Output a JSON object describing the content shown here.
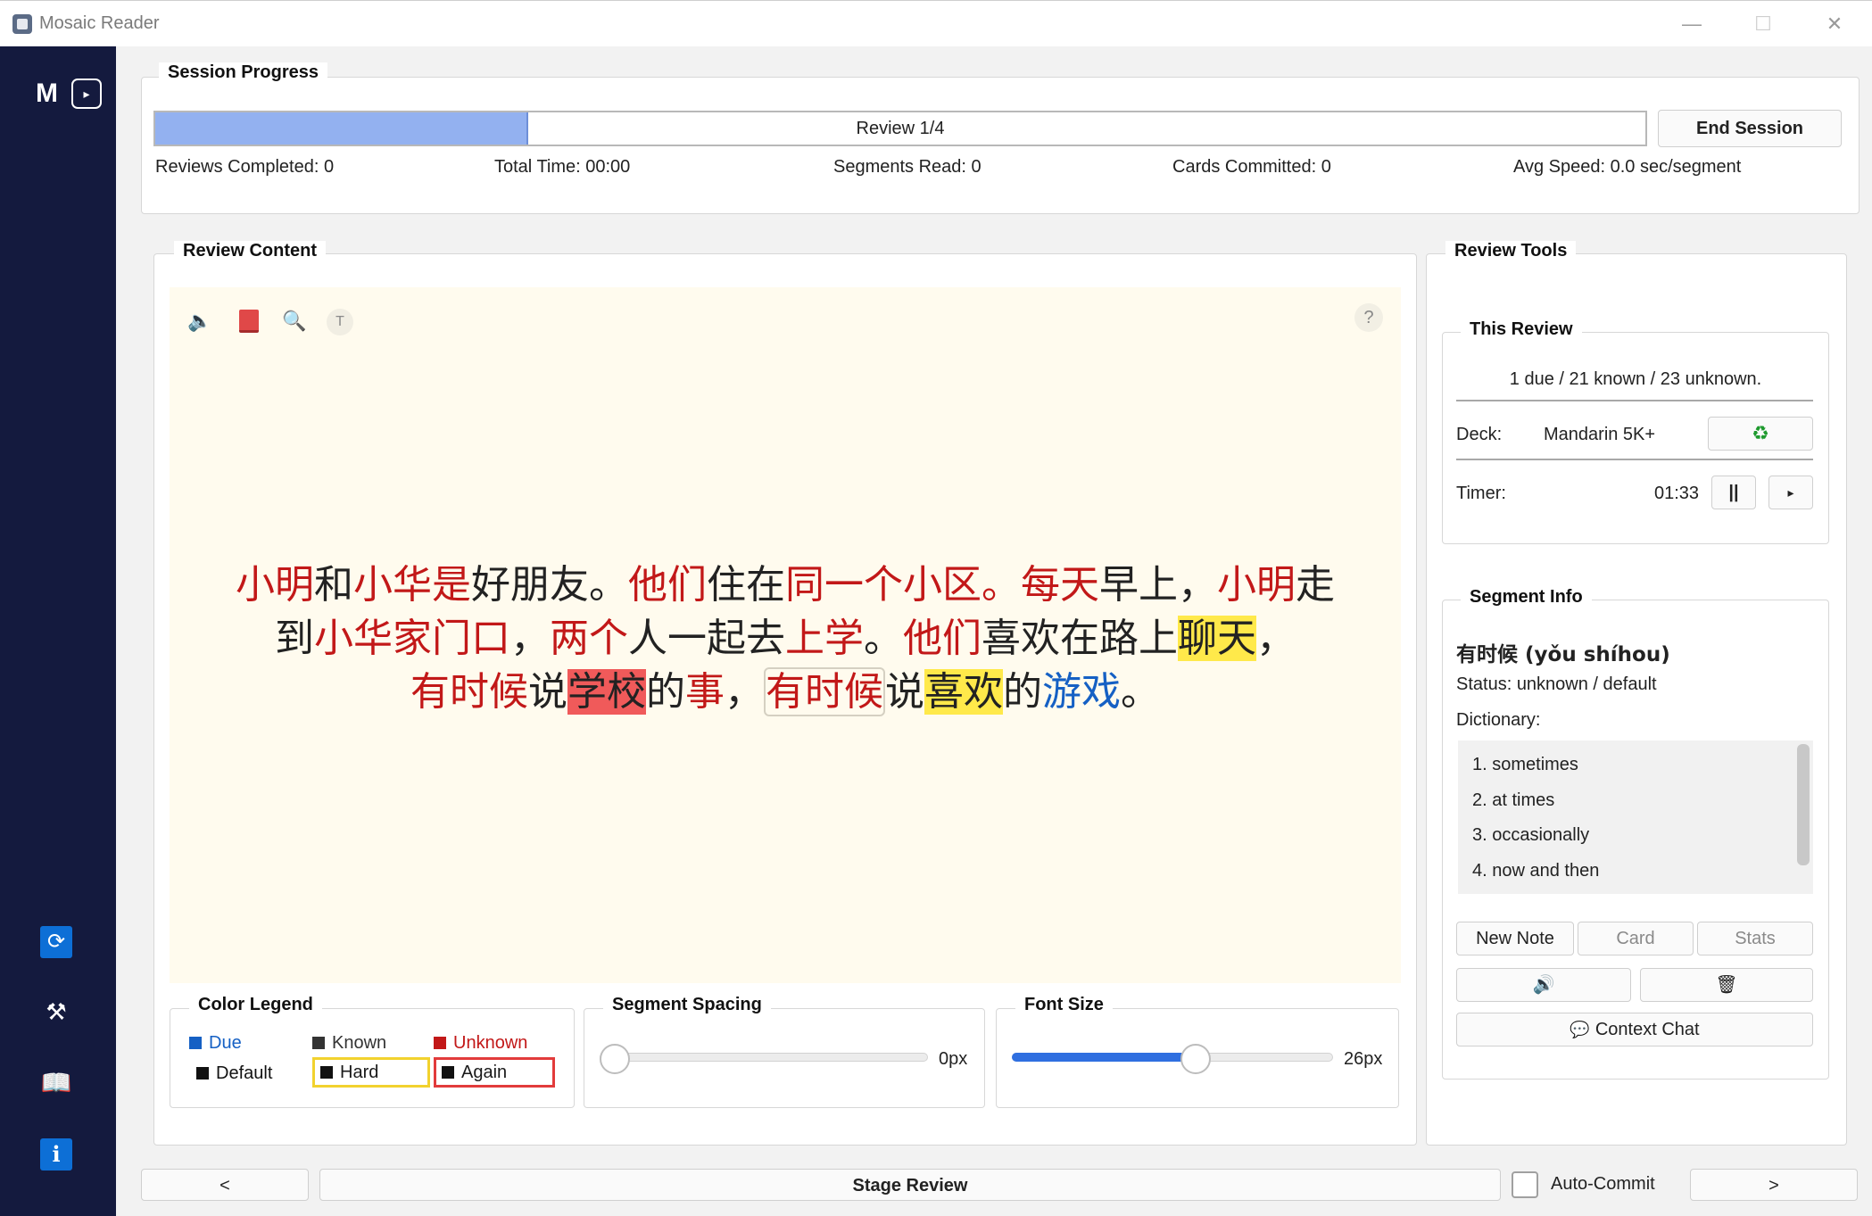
{
  "window": {
    "title": "Mosaic Reader",
    "controls": {
      "minimize": "—",
      "maximize": "☐",
      "close": "✕"
    }
  },
  "sidebar": {
    "logo_letter": "M",
    "logo_icon": "▸",
    "icons": [
      {
        "name": "sync-icon",
        "glyph": "⟳"
      },
      {
        "name": "wrench-icon",
        "glyph": "⚒"
      },
      {
        "name": "book-icon",
        "glyph": "📖"
      },
      {
        "name": "info-icon",
        "glyph": "i"
      }
    ]
  },
  "session": {
    "title": "Session Progress",
    "progress_label": "Review 1/4",
    "progress_fraction": 0.25,
    "end_button": "End Session",
    "stats": {
      "reviews_completed": "Reviews Completed: 0",
      "total_time": "Total Time: 00:00",
      "segments_read": "Segments Read: 0",
      "cards_committed": "Cards Committed: 0",
      "avg_speed": "Avg Speed: 0.0 sec/segment"
    }
  },
  "review_content": {
    "title": "Review Content",
    "toolbar": {
      "speaker_icon": "🔈",
      "book_icon": "▮",
      "search_icon": "🔍",
      "text_icon": "T",
      "help_icon": "?"
    },
    "passage": {
      "line1": [
        {
          "t": "小明",
          "s": "u"
        },
        {
          "t": "和",
          "s": "n"
        },
        {
          "t": "小华是",
          "s": "u"
        },
        {
          "t": "好朋友。",
          "s": "n"
        },
        {
          "t": "他们",
          "s": "u"
        },
        {
          "t": "住在",
          "s": "n"
        },
        {
          "t": "同一个小区。每天",
          "s": "u"
        },
        {
          "t": "早上，",
          "s": "n"
        },
        {
          "t": "小明",
          "s": "u"
        },
        {
          "t": "走",
          "s": "n"
        }
      ],
      "line2": [
        {
          "t": "到",
          "s": "n"
        },
        {
          "t": "小华家门口",
          "s": "u"
        },
        {
          "t": "，",
          "s": "n"
        },
        {
          "t": "两个",
          "s": "u"
        },
        {
          "t": "人一起去",
          "s": "n"
        },
        {
          "t": "上学",
          "s": "u"
        },
        {
          "t": "。",
          "s": "n"
        },
        {
          "t": "他们",
          "s": "u"
        },
        {
          "t": "喜欢在路上",
          "s": "n"
        },
        {
          "t": "聊天",
          "s": "hy"
        },
        {
          "t": "，",
          "s": "n"
        }
      ],
      "line3": [
        {
          "t": "有时候",
          "s": "u"
        },
        {
          "t": "说",
          "s": "n"
        },
        {
          "t": "学校",
          "s": "hr"
        },
        {
          "t": "的",
          "s": "n"
        },
        {
          "t": "事",
          "s": "u"
        },
        {
          "t": "，",
          "s": "n"
        },
        {
          "t": "有时候",
          "s": "ub"
        },
        {
          "t": "说",
          "s": "n"
        },
        {
          "t": "喜欢",
          "s": "hy"
        },
        {
          "t": "的",
          "s": "n"
        },
        {
          "t": "游戏",
          "s": "d"
        },
        {
          "t": "。",
          "s": "n"
        }
      ]
    }
  },
  "legend": {
    "title": "Color Legend",
    "due": "Due",
    "known": "Known",
    "unknown": "Unknown",
    "default": "Default",
    "hard": "Hard",
    "again": "Again",
    "colors": {
      "due": "#1560c4",
      "known": "#333333",
      "unknown": "#c21818",
      "hard": "#f2d22e",
      "again": "#e23b3b"
    }
  },
  "segment_spacing": {
    "title": "Segment Spacing",
    "value": "0px",
    "level": 0.0
  },
  "font_size": {
    "title": "Font Size",
    "value": "26px",
    "level": 0.58
  },
  "review_tools": {
    "title": "Review Tools",
    "this_review": {
      "title": "This Review",
      "summary": "1 due / 21 known / 23 unknown.",
      "deck_label": "Deck:",
      "deck_value": "Mandarin 5K+",
      "deck_icon": "♻",
      "timer_label": "Timer:",
      "timer_value": "01:33",
      "pause_glyph": "||",
      "play_glyph": "▸"
    },
    "segment_info": {
      "title": "Segment Info",
      "word": "有时候 (yǒu shíhou)",
      "status": "Status: unknown / default",
      "dictionary_label": "Dictionary:",
      "definitions": [
        "1. sometimes",
        "2. at times",
        "3. occasionally",
        "4. now and then"
      ],
      "buttons": {
        "new_note": "New Note",
        "card": "Card",
        "stats": "Stats"
      },
      "speaker_icon": "🔊",
      "trash_icon": "🗑",
      "context_chat": "Context Chat",
      "chat_icon": "💬"
    }
  },
  "bottom": {
    "prev": "<",
    "stage_review": "Stage Review",
    "auto_commit": "Auto-Commit",
    "next": ">"
  }
}
